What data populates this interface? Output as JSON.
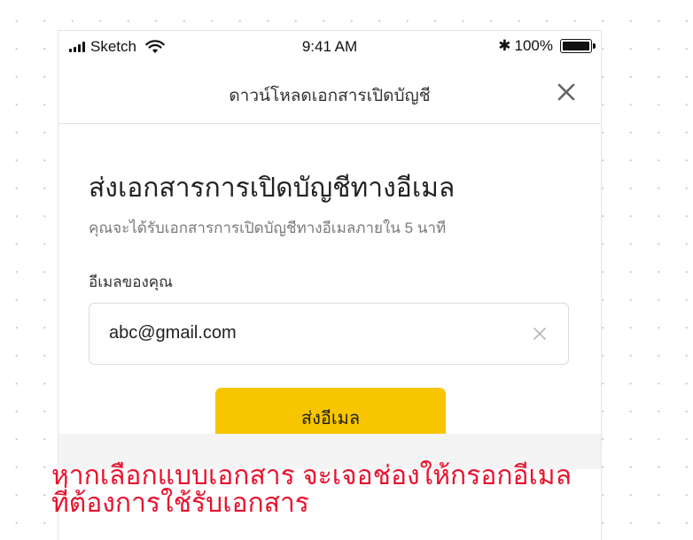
{
  "status_bar": {
    "carrier": "Sketch",
    "time": "9:41 AM",
    "battery": "100%",
    "signal_icon": "signal-bars-icon",
    "wifi_icon": "wifi-icon",
    "bluetooth_icon": "bluetooth-icon",
    "battery_icon": "battery-full-icon"
  },
  "nav": {
    "title": "ดาวน์โหลดเอกสารเปิดบัญชี",
    "close_icon": "close-icon"
  },
  "form": {
    "heading": "ส่งเอกสารการเปิดบัญชีทางอีเมล",
    "subtext": "คุณจะได้รับเอกสารการเปิดบัญชีทางอีเมลภายใน 5 นาที",
    "email_label": "อีเมลของคุณ",
    "email_value": "abc@gmail.com",
    "clear_icon": "clear-x-icon",
    "send_button": "ส่งอีเมล"
  },
  "annotation": {
    "line1": "หากเลือกแบบเอกสาร จะเจอช่องให้กรอกอีเมล",
    "line2": "ที่ต้องการใช้รับเอกสาร"
  },
  "colors": {
    "accent": "#f7c600",
    "annotation": "#e8132e",
    "text_primary": "#222222",
    "text_secondary": "#7a7a7a"
  }
}
